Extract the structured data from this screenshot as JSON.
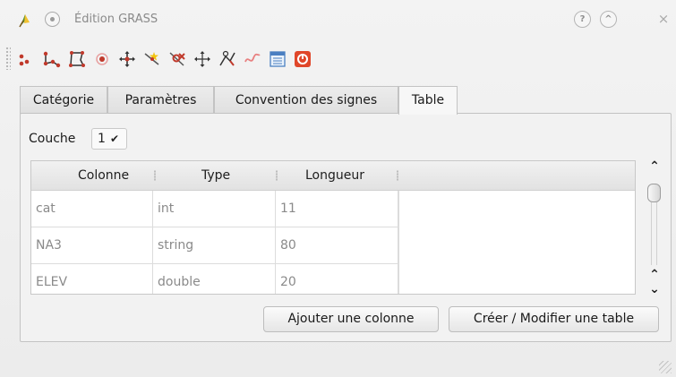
{
  "window": {
    "title": "Édition GRASS",
    "help_icon": "?",
    "shade_icon": "^",
    "close_icon": "×"
  },
  "toolbar": {
    "tools": [
      "new-point-icon",
      "new-line-icon",
      "new-boundary-icon",
      "new-centroid-icon",
      "move-vertex-icon",
      "add-vertex-icon",
      "delete-vertex-icon",
      "move-element-icon",
      "split-line-icon",
      "delete-element-icon",
      "edit-attributes-icon",
      "close-icon"
    ]
  },
  "tabs": [
    {
      "label": "Catégorie",
      "active": false
    },
    {
      "label": "Paramètres",
      "active": false
    },
    {
      "label": "Convention des signes",
      "active": false
    },
    {
      "label": "Table",
      "active": true
    }
  ],
  "layer": {
    "label": "Couche",
    "value": "1"
  },
  "table": {
    "headers": [
      "Colonne",
      "Type",
      "Longueur"
    ],
    "rows": [
      [
        "cat",
        "int",
        "11"
      ],
      [
        "NA3",
        "string",
        "80"
      ],
      [
        "ELEV",
        "double",
        "20"
      ]
    ]
  },
  "buttons": {
    "add_column": "Ajouter une colonne",
    "create_modify": "Créer / Modifier une table"
  },
  "colors": {
    "accent_red": "#c0392b",
    "panel_bg": "#f2f2f2"
  }
}
